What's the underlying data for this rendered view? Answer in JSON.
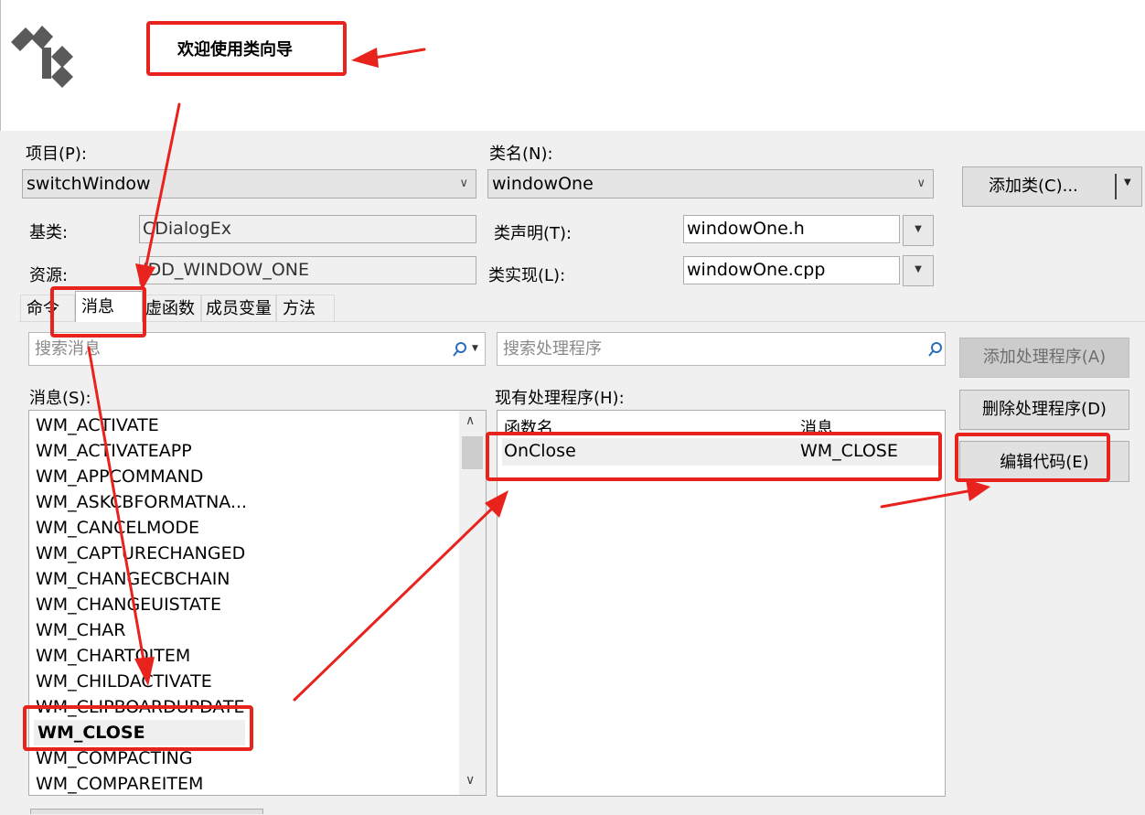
{
  "wizard": {
    "title": "欢迎使用类向导",
    "logo_icon": "class-hierarchy-icon"
  },
  "project": {
    "label": "项目(P):",
    "value": "switchWindow"
  },
  "class_name": {
    "label": "类名(N):",
    "value": "windowOne"
  },
  "add_class_button": {
    "label": "添加类(C)...",
    "menu_icon": "dropdown-arrow-icon"
  },
  "base_class": {
    "label": "基类:",
    "value": "CDialogEx"
  },
  "resource": {
    "label": "资源:",
    "value": "IDD_WINDOW_ONE"
  },
  "class_decl": {
    "label": "类声明(T):",
    "value": "windowOne.h"
  },
  "class_impl": {
    "label": "类实现(L):",
    "value": "windowOne.cpp"
  },
  "tabs": [
    {
      "label": "命令"
    },
    {
      "label": "消息"
    },
    {
      "label": "虚函数"
    },
    {
      "label": "成员变量"
    },
    {
      "label": "方法"
    }
  ],
  "active_tab": "消息",
  "message_search": {
    "placeholder": "搜索消息"
  },
  "handler_search": {
    "placeholder": "搜索处理程序"
  },
  "messages": {
    "label": "消息(S):",
    "items": [
      "WM_ACTIVATE",
      "WM_ACTIVATEAPP",
      "WM_APPCOMMAND",
      "WM_ASKCBFORMATNA...",
      "WM_CANCELMODE",
      "WM_CAPTURECHANGED",
      "WM_CHANGECBCHAIN",
      "WM_CHANGEUISTATE",
      "WM_CHAR",
      "WM_CHARTOITEM",
      "WM_CHILDACTIVATE",
      "WM_CLIPBOARDUPDATE",
      "WM_CLOSE",
      "WM_COMPACTING",
      "WM_COMPAREITEM"
    ],
    "selected": "WM_CLOSE"
  },
  "handlers": {
    "label": "现有处理程序(H):",
    "columns": [
      "函数名",
      "消息"
    ],
    "rows": [
      {
        "function": "OnClose",
        "message": "WM_CLOSE"
      }
    ]
  },
  "buttons": {
    "add_handler": "添加处理程序(A)",
    "delete_handler": "删除处理程序(D)",
    "edit_code": "编辑代码(E)"
  },
  "annotation_color": "#e8231e"
}
